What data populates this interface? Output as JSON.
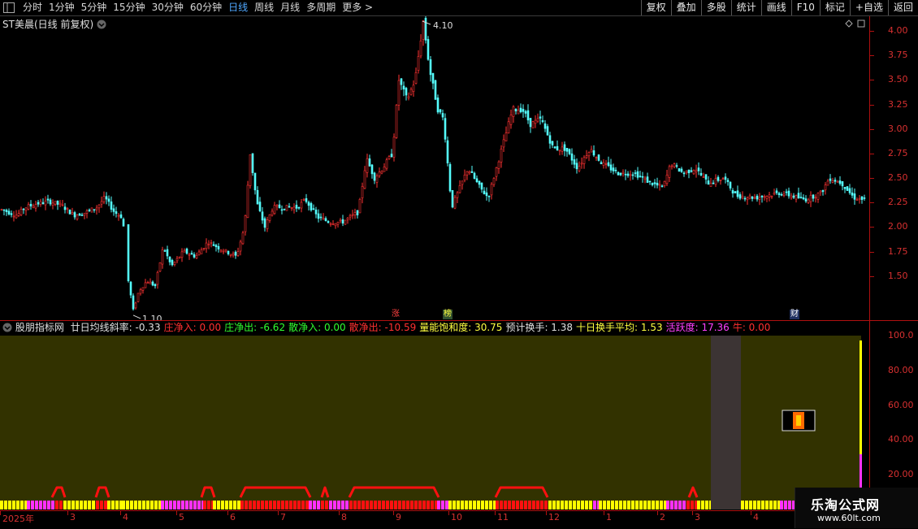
{
  "toolbar": {
    "periods": [
      "分时",
      "1分钟",
      "5分钟",
      "15分钟",
      "30分钟",
      "60分钟",
      "日线",
      "周线",
      "月线",
      "多周期",
      "更多 >"
    ],
    "active_period": "日线",
    "right_buttons": [
      "复权",
      "叠加",
      "多股",
      "统计",
      "画线",
      "F10",
      "标记",
      "+自选",
      "返回"
    ]
  },
  "main": {
    "title": "ST美晨(日线 前复权)",
    "high_label": "4.10",
    "low_label": "1.10",
    "badges": [
      "涨",
      "榜",
      "财"
    ]
  },
  "indicator": {
    "name": "股朋指标网",
    "fields": [
      {
        "label": "廿日均线斜率: ",
        "value": "-0.33",
        "color": "#e0e0e0"
      },
      {
        "label": "庄净入: ",
        "value": "0.00",
        "color": "#ff3030"
      },
      {
        "label": "庄净出: ",
        "value": "-6.62",
        "color": "#30ff30"
      },
      {
        "label": "散净入: ",
        "value": "0.00",
        "color": "#30ff30"
      },
      {
        "label": "散净出: ",
        "value": "-10.59",
        "color": "#ff3030"
      },
      {
        "label": "量能饱和度: ",
        "value": "30.75",
        "color": "#ffff40"
      },
      {
        "label": "预计换手: ",
        "value": "1.38",
        "color": "#e0e0e0"
      },
      {
        "label": "十日换手平均: ",
        "value": "1.53",
        "color": "#ffff40"
      },
      {
        "label": "活跃度: ",
        "value": "17.36",
        "color": "#ff40ff"
      },
      {
        "label": "牛: ",
        "value": "0.00",
        "color": "#ff3030"
      }
    ],
    "axis_labels": [
      "100.0",
      "80.00",
      "60.00",
      "40.00",
      "20.00"
    ]
  },
  "chart_data": {
    "type": "candlestick",
    "price_axis_ticks": [
      "4.00",
      "3.75",
      "3.50",
      "3.25",
      "3.00",
      "2.75",
      "2.50",
      "2.25",
      "2.00",
      "1.75",
      "1.50"
    ],
    "ylim": [
      1.05,
      4.15
    ],
    "x_labels": [
      "2025年",
      "3",
      "4",
      "5",
      "6",
      "7",
      "8",
      "9",
      "10",
      "11",
      "12",
      "1",
      "2",
      "3",
      "4"
    ],
    "price_path": [
      [
        0,
        2.18
      ],
      [
        10,
        2.15
      ],
      [
        20,
        2.12
      ],
      [
        30,
        2.2
      ],
      [
        45,
        2.24
      ],
      [
        60,
        2.26
      ],
      [
        75,
        2.22
      ],
      [
        90,
        2.12
      ],
      [
        105,
        2.15
      ],
      [
        118,
        2.2
      ],
      [
        128,
        2.3
      ],
      [
        140,
        2.15
      ],
      [
        150,
        2.1
      ],
      [
        157,
        1.45
      ],
      [
        163,
        1.15
      ],
      [
        170,
        1.35
      ],
      [
        180,
        1.45
      ],
      [
        190,
        1.4
      ],
      [
        200,
        1.8
      ],
      [
        210,
        1.6
      ],
      [
        225,
        1.75
      ],
      [
        240,
        1.7
      ],
      [
        255,
        1.85
      ],
      [
        270,
        1.78
      ],
      [
        290,
        1.7
      ],
      [
        300,
        2.0
      ],
      [
        307,
        2.75
      ],
      [
        315,
        2.25
      ],
      [
        325,
        2.0
      ],
      [
        335,
        2.2
      ],
      [
        350,
        2.2
      ],
      [
        365,
        2.2
      ],
      [
        375,
        2.28
      ],
      [
        390,
        2.1
      ],
      [
        405,
        2.05
      ],
      [
        420,
        2.05
      ],
      [
        440,
        2.15
      ],
      [
        450,
        2.7
      ],
      [
        460,
        2.5
      ],
      [
        470,
        2.6
      ],
      [
        482,
        2.75
      ],
      [
        490,
        3.5
      ],
      [
        500,
        3.3
      ],
      [
        510,
        3.5
      ],
      [
        520,
        4.1
      ],
      [
        528,
        3.6
      ],
      [
        538,
        3.2
      ],
      [
        545,
        3.1
      ],
      [
        555,
        2.2
      ],
      [
        565,
        2.4
      ],
      [
        575,
        2.6
      ],
      [
        590,
        2.4
      ],
      [
        600,
        2.3
      ],
      [
        610,
        2.6
      ],
      [
        620,
        2.9
      ],
      [
        630,
        3.2
      ],
      [
        642,
        3.2
      ],
      [
        652,
        3.05
      ],
      [
        665,
        3.1
      ],
      [
        680,
        2.8
      ],
      [
        695,
        2.8
      ],
      [
        710,
        2.6
      ],
      [
        725,
        2.8
      ],
      [
        740,
        2.65
      ],
      [
        760,
        2.55
      ],
      [
        780,
        2.55
      ],
      [
        800,
        2.45
      ],
      [
        815,
        2.4
      ],
      [
        825,
        2.65
      ],
      [
        840,
        2.55
      ],
      [
        855,
        2.6
      ],
      [
        870,
        2.45
      ],
      [
        890,
        2.5
      ],
      [
        905,
        2.32
      ],
      [
        930,
        2.3
      ],
      [
        960,
        2.35
      ],
      [
        990,
        2.28
      ],
      [
        1010,
        2.35
      ],
      [
        1020,
        2.5
      ],
      [
        1035,
        2.45
      ],
      [
        1050,
        2.3
      ],
      [
        1062,
        2.28
      ]
    ],
    "indicator_ylim": [
      0,
      100
    ],
    "bars": [
      [
        0,
        33,
        "yellow"
      ],
      [
        33,
        68,
        "magenta"
      ],
      [
        68,
        78,
        "red"
      ],
      [
        78,
        118,
        "yellow"
      ],
      [
        118,
        132,
        "red"
      ],
      [
        132,
        150,
        "yellow"
      ],
      [
        150,
        198,
        "yellow"
      ],
      [
        198,
        250,
        "magenta"
      ],
      [
        250,
        262,
        "red"
      ],
      [
        262,
        296,
        "yellow"
      ],
      [
        296,
        380,
        "red"
      ],
      [
        380,
        395,
        "magenta"
      ],
      [
        395,
        405,
        "red"
      ],
      [
        405,
        430,
        "magenta"
      ],
      [
        430,
        538,
        "red"
      ],
      [
        538,
        552,
        "magenta"
      ],
      [
        552,
        610,
        "yellow"
      ],
      [
        610,
        675,
        "red"
      ],
      [
        675,
        730,
        "yellow"
      ],
      [
        730,
        737,
        "magenta"
      ],
      [
        737,
        820,
        "yellow"
      ],
      [
        820,
        845,
        "magenta"
      ],
      [
        845,
        858,
        "red"
      ],
      [
        858,
        875,
        "yellow"
      ],
      [
        875,
        912,
        "gap"
      ],
      [
        912,
        960,
        "yellow"
      ],
      [
        960,
        978,
        "magenta"
      ],
      [
        978,
        1060,
        "yellow"
      ]
    ],
    "line_segments": [
      [
        [
          64,
          612
        ],
        [
          70,
          600
        ],
        [
          76,
          600
        ],
        [
          80,
          612
        ]
      ],
      [
        [
          118,
          612
        ],
        [
          122,
          600
        ],
        [
          130,
          600
        ],
        [
          134,
          612
        ]
      ],
      [
        [
          248,
          612
        ],
        [
          252,
          600
        ],
        [
          260,
          600
        ],
        [
          264,
          612
        ]
      ],
      [
        [
          296,
          612
        ],
        [
          302,
          600
        ],
        [
          376,
          600
        ],
        [
          382,
          612
        ]
      ],
      [
        [
          396,
          612
        ],
        [
          400,
          600
        ],
        [
          404,
          612
        ]
      ],
      [
        [
          430,
          612
        ],
        [
          436,
          600
        ],
        [
          534,
          600
        ],
        [
          540,
          612
        ]
      ],
      [
        [
          610,
          612
        ],
        [
          616,
          600
        ],
        [
          668,
          600
        ],
        [
          674,
          612
        ]
      ],
      [
        [
          848,
          612
        ],
        [
          853,
          600
        ],
        [
          858,
          612
        ]
      ]
    ]
  }
}
